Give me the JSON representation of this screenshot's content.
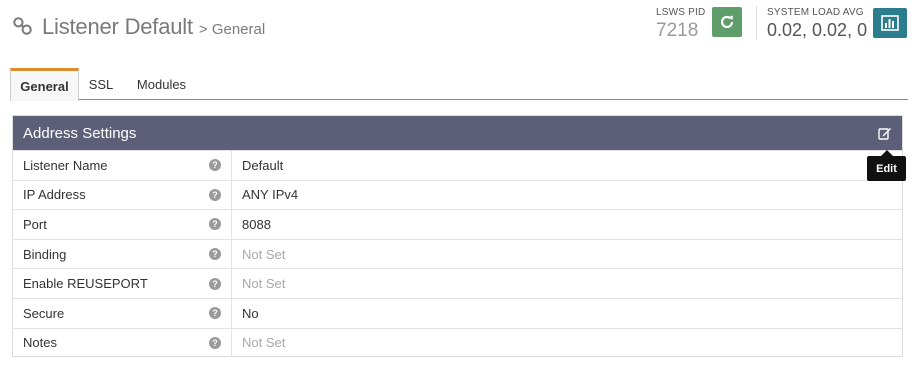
{
  "header": {
    "title": "Listener Default",
    "breadcrumb": "> General",
    "pid_label": "LSWS PID",
    "pid_value": "7218",
    "load_label": "SYSTEM LOAD AVG",
    "load_value": "0.02, 0.02, 0"
  },
  "tabs": [
    {
      "label": "General",
      "active": true
    },
    {
      "label": "SSL",
      "active": false
    },
    {
      "label": "Modules",
      "active": false
    }
  ],
  "panel": {
    "title": "Address Settings",
    "edit_tooltip": "Edit",
    "rows": [
      {
        "label": "Listener Name",
        "value": "Default",
        "not_set": false
      },
      {
        "label": "IP Address",
        "value": "ANY IPv4",
        "not_set": false
      },
      {
        "label": "Port",
        "value": "8088",
        "not_set": false
      },
      {
        "label": "Binding",
        "value": "Not Set",
        "not_set": true
      },
      {
        "label": "Enable REUSEPORT",
        "value": "Not Set",
        "not_set": true
      },
      {
        "label": "Secure",
        "value": "No",
        "not_set": false
      },
      {
        "label": "Notes",
        "value": "Not Set",
        "not_set": true
      }
    ]
  },
  "colors": {
    "reload_button": "#5f9d6a",
    "chart_button": "#2b7d8e",
    "panel_header": "#5d5e78",
    "active_tab_accent": "#e08a2e"
  },
  "icons": {
    "title": "link-icon",
    "reload": "refresh-icon",
    "load": "bar-chart-icon",
    "edit": "edit-icon",
    "help": "question-circle-icon"
  }
}
